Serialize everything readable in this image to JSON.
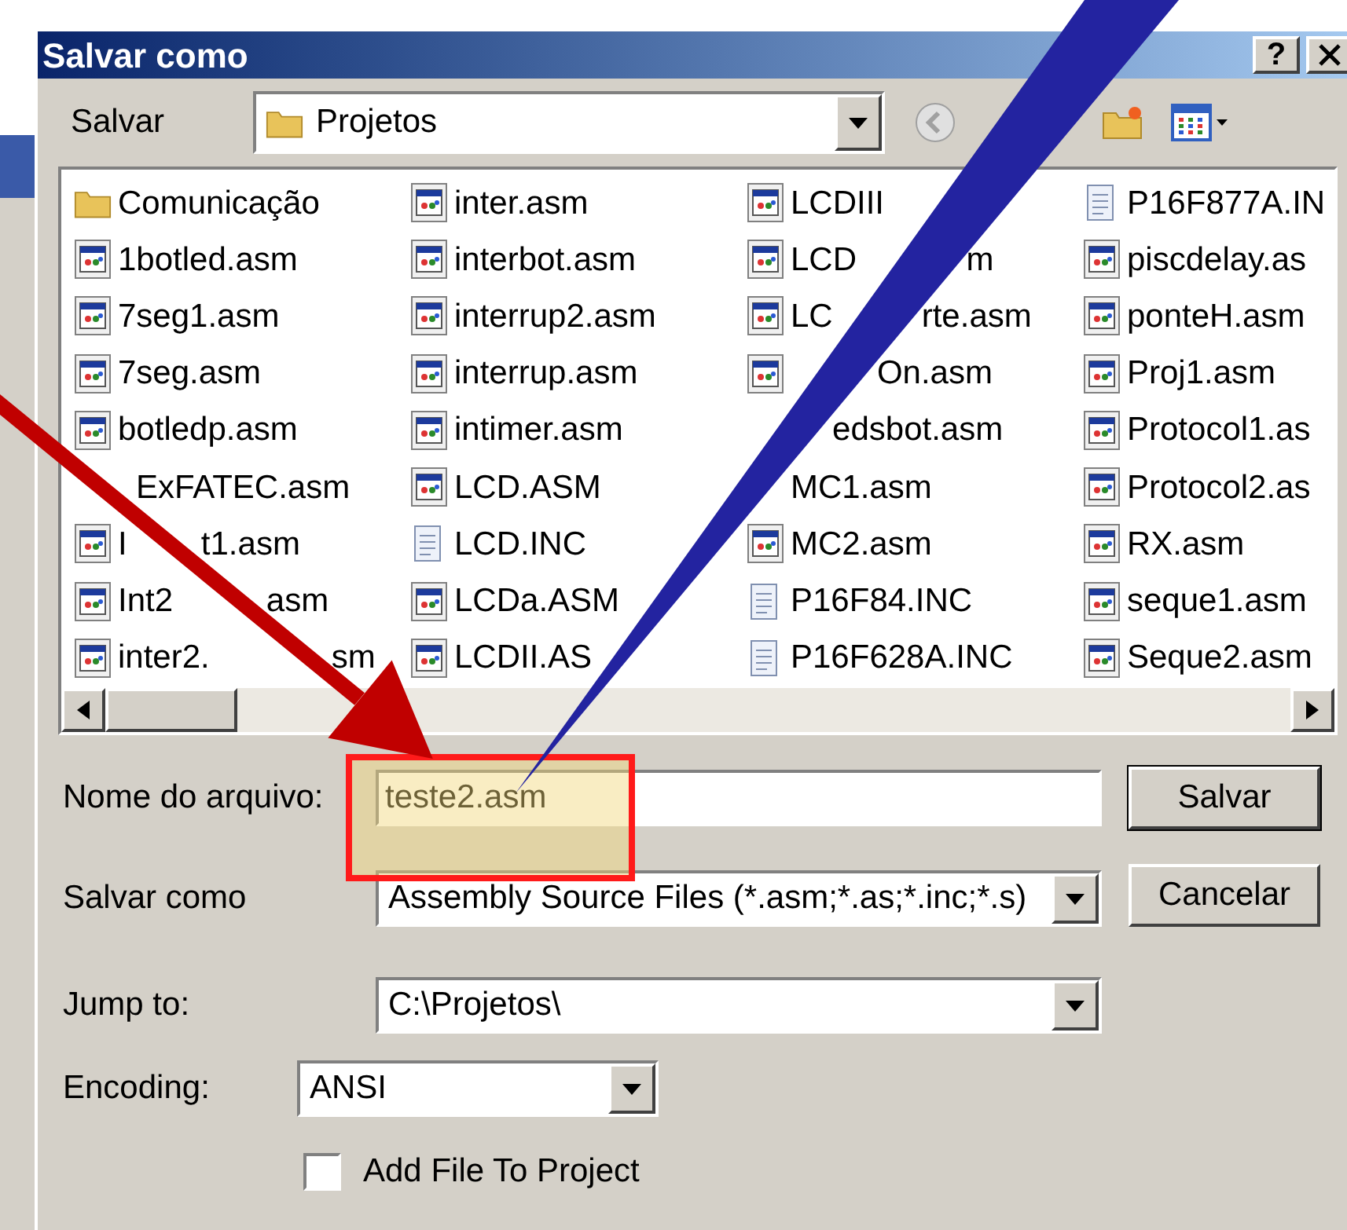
{
  "dialog": {
    "title": "Salvar como",
    "help_button": "?"
  },
  "location": {
    "label": "Salvar",
    "value": "Projetos"
  },
  "files": [
    {
      "name": "Comunicação",
      "kind": "folder"
    },
    {
      "name": "1botled.asm",
      "kind": "asm"
    },
    {
      "name": "7seg1.asm",
      "kind": "asm"
    },
    {
      "name": "7seg.asm",
      "kind": "asm"
    },
    {
      "name": "botledp.asm",
      "kind": "asm"
    },
    {
      "name": "ExFATEC.asm",
      "kind": "asm"
    },
    {
      "segments": [
        "I",
        "t1.asm"
      ],
      "kind": "asm"
    },
    {
      "segments": [
        "Int2",
        "asm"
      ],
      "kind": "asm"
    },
    {
      "segments": [
        "inter2.",
        "sm"
      ],
      "kind": "asm"
    },
    {
      "name": "inter.asm",
      "kind": "asm"
    },
    {
      "name": "interbot.asm",
      "kind": "asm"
    },
    {
      "name": "interrup2.asm",
      "kind": "asm"
    },
    {
      "name": "interrup.asm",
      "kind": "asm"
    },
    {
      "name": "intimer.asm",
      "kind": "asm"
    },
    {
      "name": "LCD.ASM",
      "kind": "asm"
    },
    {
      "name": "LCD.INC",
      "kind": "inc"
    },
    {
      "name": "LCDa.ASM",
      "kind": "asm"
    },
    {
      "name": "LCDII.AS",
      "kind": "asm"
    },
    {
      "name": "LCDIII",
      "kind": "asm"
    },
    {
      "segments": [
        "LCD",
        "m"
      ],
      "kind": "asm"
    },
    {
      "segments": [
        "LC",
        "rte.asm"
      ],
      "kind": "asm"
    },
    {
      "name": "On.asm",
      "kind": "asm"
    },
    {
      "name": "edsbot.asm",
      "kind": "asm"
    },
    {
      "name": "MC1.asm",
      "kind": "asm"
    },
    {
      "name": "MC2.asm",
      "kind": "asm"
    },
    {
      "name": "P16F84.INC",
      "kind": "inc"
    },
    {
      "name": "P16F628A.INC",
      "kind": "inc"
    },
    {
      "name": "P16F877A.IN",
      "kind": "inc"
    },
    {
      "name": "piscdelay.as",
      "kind": "asm"
    },
    {
      "name": "ponteH.asm",
      "kind": "asm"
    },
    {
      "name": "Proj1.asm",
      "kind": "asm"
    },
    {
      "name": "Protocol1.as",
      "kind": "asm"
    },
    {
      "name": "Protocol2.as",
      "kind": "asm"
    },
    {
      "name": "RX.asm",
      "kind": "asm"
    },
    {
      "name": "seque1.asm",
      "kind": "asm"
    },
    {
      "name": "Seque2.asm",
      "kind": "asm"
    }
  ],
  "file_name": {
    "label": "Nome do arquivo:",
    "value": "teste2.asm"
  },
  "save_as_type": {
    "label": "Salvar como",
    "value": "Assembly Source Files (*.asm;*.as;*.inc;*.s)"
  },
  "jump_to": {
    "label": "Jump to:",
    "value": "C:\\Projetos\\"
  },
  "encoding": {
    "label": "Encoding:",
    "value": "ANSI"
  },
  "add_to_project": {
    "label": "Add File To Project",
    "checked": false
  },
  "buttons": [
    "Salvar",
    "Cancelar"
  ]
}
